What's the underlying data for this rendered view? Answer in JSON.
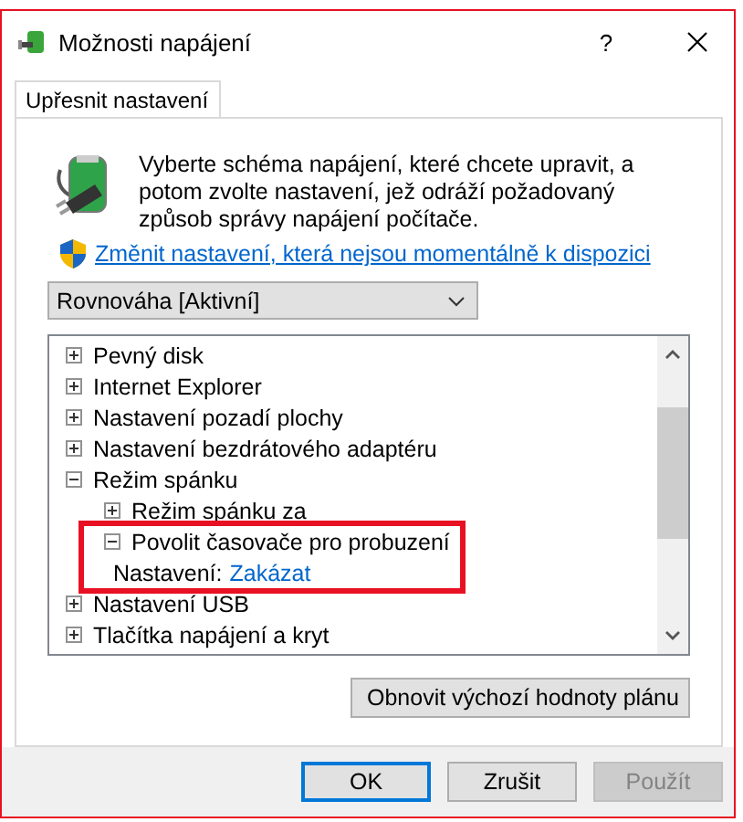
{
  "window": {
    "title": "Možnosti napájení",
    "help": "?"
  },
  "tabs": [
    {
      "label": "Upřesnit nastavení",
      "selected": true
    }
  ],
  "description": "Vyberte schéma napájení, které chcete upravit, a potom zvolte nastavení, jež odráží požadovaný způsob správy napájení počítače.",
  "admin_link": "Změnit nastavení, která nejsou momentálně k dispozici",
  "plan_dropdown": {
    "value": "Rovnováha [Aktivní]"
  },
  "settings_tree": [
    {
      "kind": "group",
      "label": "Pevný disk",
      "expanded": false
    },
    {
      "kind": "group",
      "label": "Internet Explorer",
      "expanded": false
    },
    {
      "kind": "group",
      "label": "Nastavení pozadí plochy",
      "expanded": false
    },
    {
      "kind": "group",
      "label": "Nastavení bezdrátového adaptéru",
      "expanded": false
    },
    {
      "kind": "group",
      "label": "Režim spánku",
      "expanded": true,
      "children": [
        {
          "kind": "group",
          "label": "Režim spánku za",
          "expanded": false
        },
        {
          "kind": "group",
          "label": "Povolit časovače pro probuzení",
          "expanded": true,
          "highlighted": true,
          "children": [
            {
              "kind": "setting",
              "label": "Nastavení:",
              "value": "Zakázat"
            }
          ]
        }
      ]
    },
    {
      "kind": "group",
      "label": "Nastavení USB",
      "expanded": false
    },
    {
      "kind": "group",
      "label": "Tlačítka napájení a kryt",
      "expanded": false
    }
  ],
  "restore_button": "Obnovit výchozí hodnoty plánu",
  "buttons": [
    {
      "label": "OK",
      "default": true,
      "disabled": false
    },
    {
      "label": "Zrušit",
      "default": false,
      "disabled": false
    },
    {
      "label": "Použít",
      "default": false,
      "disabled": true
    }
  ]
}
